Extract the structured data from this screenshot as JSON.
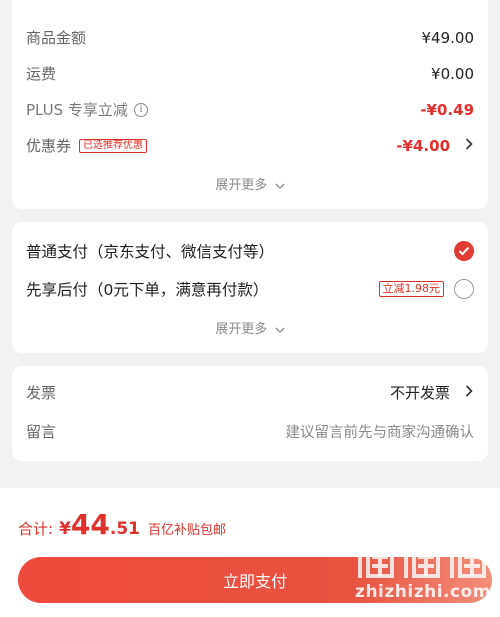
{
  "summary": {
    "goods_amount_label": "商品金额",
    "goods_amount_value": "¥49.00",
    "shipping_label": "运费",
    "shipping_value": "¥0.00",
    "plus_label": "PLUS 专享立减",
    "plus_value": "-¥0.49",
    "coupon_label": "优惠券",
    "coupon_tag": "已选推荐优惠",
    "coupon_value": "-¥4.00",
    "expand_label": "展开更多"
  },
  "payment": {
    "option1_label": "普通支付（京东支付、微信支付等）",
    "option1_selected": true,
    "option2_label": "先享后付（0元下单，满意再付款）",
    "option2_tag": "立减1.98元",
    "option2_selected": false,
    "expand_label": "展开更多"
  },
  "extras": {
    "invoice_label": "发票",
    "invoice_value": "不开发票",
    "note_label": "留言",
    "note_placeholder": "建议留言前先与商家沟通确认"
  },
  "footer": {
    "total_label": "合计:",
    "currency": "¥",
    "total_integer": "44",
    "total_decimal": ".51",
    "subsidy_text": "百亿补贴包邮",
    "pay_button": "立即支付"
  },
  "watermark": {
    "text": "zhizhizhi.com"
  },
  "colors": {
    "accent": "#e0302c",
    "background": "#f2f2f2"
  },
  "icons": [
    "info-icon",
    "chevron-right-icon",
    "chevron-down-icon",
    "check-icon"
  ]
}
